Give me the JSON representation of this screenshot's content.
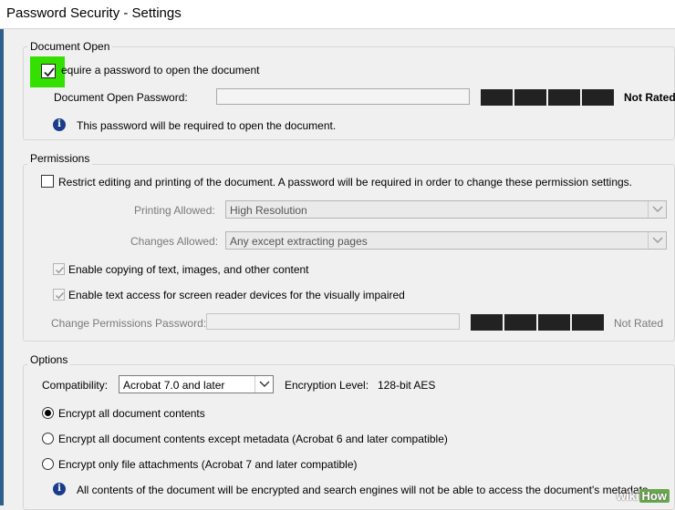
{
  "window": {
    "title": "Password Security - Settings"
  },
  "document_open": {
    "group_label": "Document Open",
    "require_label": "equire a password to open the document",
    "require_checked": true,
    "password_label": "Document Open Password:",
    "password_value": "",
    "strength": "Not Rated",
    "info_text": "This password will be required to open the document."
  },
  "permissions": {
    "group_label": "Permissions",
    "restrict_label": "Restrict editing and printing of the document. A password will be required in order to change these permission settings.",
    "restrict_checked": false,
    "printing_label": "Printing Allowed:",
    "printing_value": "High Resolution",
    "changes_label": "Changes Allowed:",
    "changes_value": "Any except extracting pages",
    "copy_label": "Enable copying of text, images, and other content",
    "copy_checked": true,
    "screenreader_label": "Enable text access for screen reader devices for the visually impaired",
    "screenreader_checked": true,
    "perm_password_label": "Change Permissions Password:",
    "perm_password_value": "",
    "strength": "Not Rated"
  },
  "options": {
    "group_label": "Options",
    "compat_label": "Compatibility:",
    "compat_value": "Acrobat 7.0 and later",
    "encryption_label": "Encryption  Level:",
    "encryption_value": "128-bit AES",
    "radio_all": "Encrypt all document contents",
    "radio_except_meta": "Encrypt all document contents except metadata (Acrobat 6 and later compatible)",
    "radio_attachments": "Encrypt only file attachments (Acrobat 7 and later compatible)",
    "selected_radio": "radio_all",
    "info_text": "All contents of the document will be encrypted and search engines will not be able to access the document's metadata."
  },
  "watermark": {
    "wiki": "wiki",
    "how": "How"
  },
  "colors": {
    "highlight": "#35e000",
    "meter": "#222222",
    "info_icon": "#1a3c8a"
  },
  "icons": [
    "checkmark-icon",
    "info-icon",
    "chevron-down-icon"
  ]
}
